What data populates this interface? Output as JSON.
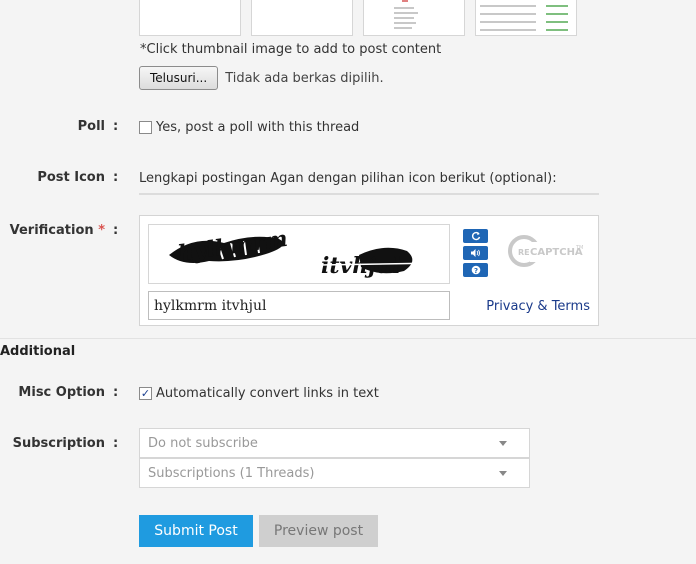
{
  "upload": {
    "hint": "*Click thumbnail image to add to post content",
    "browse_label": "Telusuri...",
    "file_status": "Tidak ada berkas dipilih."
  },
  "poll": {
    "label": "Poll",
    "colon": ":",
    "checkbox_label": "Yes, post a poll with this thread",
    "checked": false
  },
  "post_icon": {
    "label": "Post Icon",
    "colon": ":",
    "text": "Lengkapi postingan Agan dengan pilihan icon berikut (optional):"
  },
  "verification": {
    "label": "Verification",
    "required_mark": "*",
    "colon": ":",
    "captcha_input_value": "hylkmrm itvhjul",
    "privacy_link": "Privacy & Terms",
    "icons": [
      "refresh-icon",
      "audio-icon",
      "help-icon",
      "recaptcha-logo"
    ]
  },
  "additional": {
    "title": "Additional",
    "misc_option": {
      "label": "Misc Option",
      "colon": ":",
      "checkbox_label": "Automatically convert links in text",
      "checked": true
    },
    "subscription": {
      "label": "Subscription",
      "colon": ":",
      "select1": "Do not subscribe",
      "select2": "Subscriptions (1 Threads)"
    }
  },
  "actions": {
    "submit_label": "Submit Post",
    "preview_label": "Preview post"
  },
  "colors": {
    "accent": "#1f9be0",
    "link": "#1a3a8a",
    "required": "#d9534f",
    "captcha_button": "#1f66b5"
  }
}
